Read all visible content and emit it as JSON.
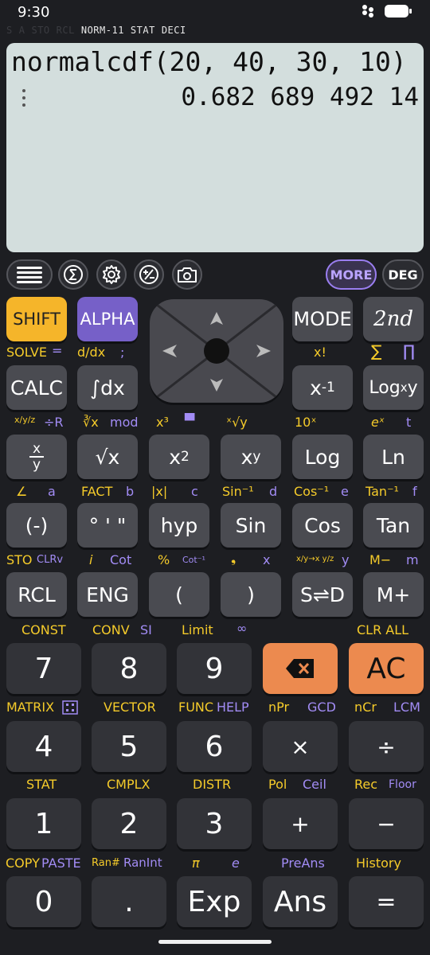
{
  "status": {
    "time": "9:30"
  },
  "indicators": {
    "dim": [
      "S",
      "A",
      "STO",
      "RCL"
    ],
    "lit": [
      "NORM-11",
      "STAT",
      "DECI"
    ]
  },
  "display": {
    "expression": "normalcdf(20, 40, 30, 10)",
    "result": "0.682 689 492 14"
  },
  "toolbar": {
    "more": "MORE",
    "deg": "DEG"
  },
  "row_shift": {
    "shift": "SHIFT",
    "alpha": "ALPHA",
    "mode": "MODE",
    "second": "2nd"
  },
  "labels_r1": {
    "solve": "SOLVE",
    "eq": "=",
    "ddx": "d/dx",
    "semicolon": ";",
    "xfact": "x!",
    "sigma": "∑",
    "pi_prod": "∏"
  },
  "row_calc": {
    "calc": "CALC",
    "integral": "∫dx",
    "xinv_base": "x",
    "xinv_sup": "-1",
    "log_base": "Log",
    "log_sub": "x",
    "log_y": "y"
  },
  "labels_r2": {
    "frac_xyz": "x/y/z",
    "div_r": "÷R",
    "cuberoot": "∛x",
    "mod": "mod",
    "xcube": "x³",
    "bar": "▀",
    "xroot": "ˣ√y",
    "tenx": "10ˣ",
    "ex": "eˣ",
    "t": "t"
  },
  "row_frac": {
    "frac_top": "x",
    "frac_bot": "y",
    "sqrt": "√x",
    "sq_base": "x",
    "sq_sup": "2",
    "pow_base": "x",
    "pow_sup": "y",
    "log": "Log",
    "ln": "Ln"
  },
  "labels_r3": {
    "angle": "∠",
    "a": "a",
    "fact": "FACT",
    "b": "b",
    "abs": "|x|",
    "c": "c",
    "asin": "Sin⁻¹",
    "d": "d",
    "acos": "Cos⁻¹",
    "e": "e",
    "atan": "Tan⁻¹",
    "f": "f"
  },
  "row_trig": {
    "neg": "(-)",
    "dms": "° ' \"",
    "hyp": "hyp",
    "sin": "Sin",
    "cos": "Cos",
    "tan": "Tan"
  },
  "labels_r4": {
    "sto": "STO",
    "clrv": "CLRv",
    "i": "i",
    "cot": "Cot",
    "pct": "%",
    "acot": "Cot⁻¹",
    "comma": "❟",
    "x": "x",
    "convert": "x/y→x y/z",
    "y": "y",
    "mminus": "M−",
    "m": "m"
  },
  "row_rcl": {
    "rcl": "RCL",
    "eng": "ENG",
    "lparen": "(",
    "rparen": ")",
    "sd": "S⇌D",
    "mplus": "M+"
  },
  "labels_r5": {
    "const": "CONST",
    "conv": "CONV",
    "si": "SI",
    "limit": "Limit",
    "inf": "∞",
    "clrall": "CLR ALL"
  },
  "row_789": {
    "seven": "7",
    "eight": "8",
    "nine": "9",
    "ac": "AC"
  },
  "labels_r6": {
    "matrix": "MATRIX",
    "vector": "VECTOR",
    "func": "FUNC",
    "help": "HELP",
    "npr": "nPr",
    "gcd": "GCD",
    "ncr": "nCr",
    "lcm": "LCM"
  },
  "row_456": {
    "four": "4",
    "five": "5",
    "six": "6",
    "times": "×",
    "divide": "÷"
  },
  "labels_r7": {
    "stat": "STAT",
    "cmplx": "CMPLX",
    "distr": "DISTR",
    "pol": "Pol",
    "ceil": "Ceil",
    "rec": "Rec",
    "floor": "Floor"
  },
  "row_123": {
    "one": "1",
    "two": "2",
    "three": "3",
    "plus": "+",
    "minus": "−"
  },
  "labels_r8": {
    "copy": "COPY",
    "paste": "PASTE",
    "ran": "Ran#",
    "ranint": "RanInt",
    "pi": "π",
    "e": "e",
    "preans": "PreAns",
    "history": "History"
  },
  "row_0": {
    "zero": "0",
    "dot": ".",
    "exp": "Exp",
    "ans": "Ans",
    "equals": "="
  }
}
